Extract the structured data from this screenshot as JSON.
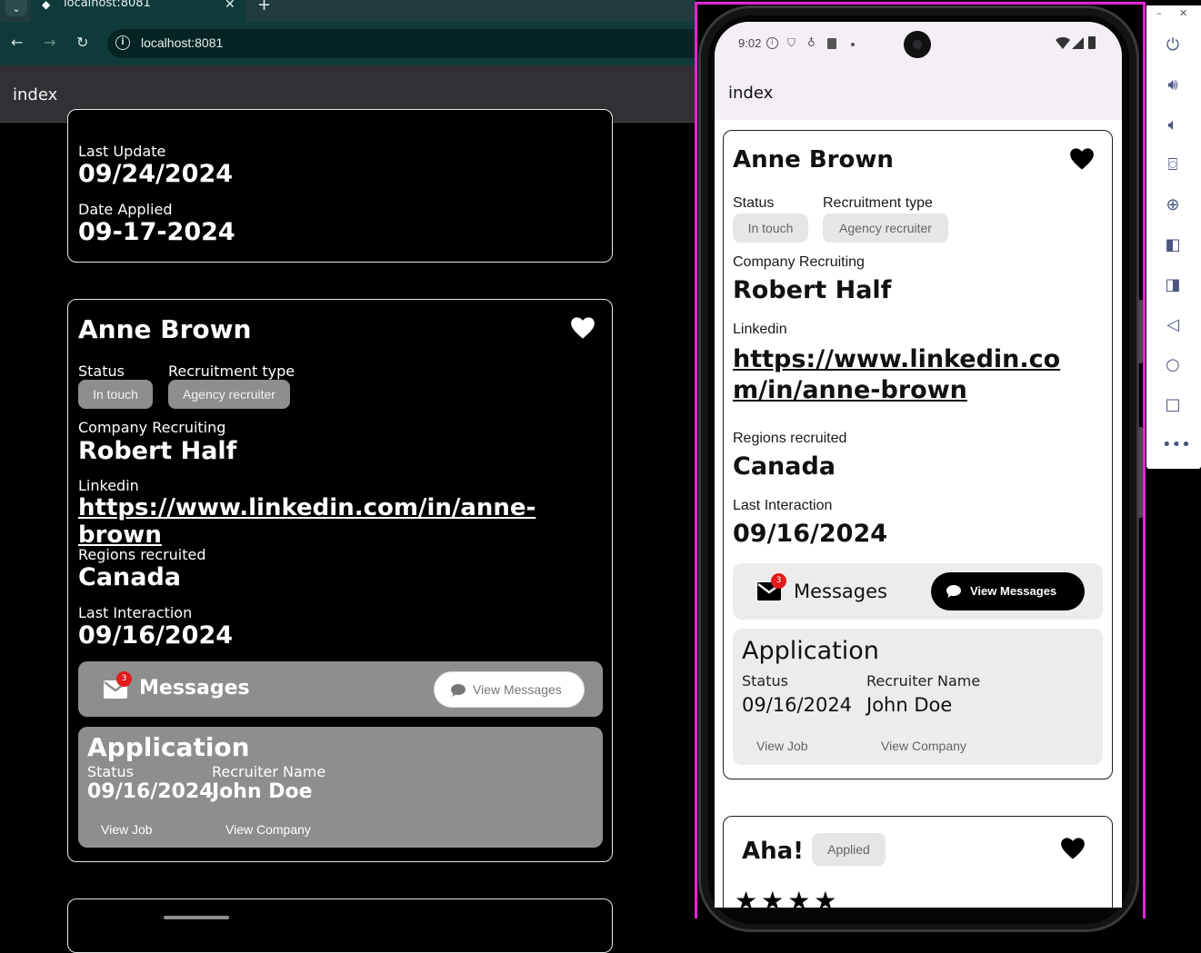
{
  "browser": {
    "tab_title": "localhost:8081",
    "url": "localhost:8081",
    "icons": [
      "tab-dropdown-icon",
      "close-icon",
      "plus-icon",
      "back-icon",
      "forward-icon",
      "reload-icon",
      "site-info-icon"
    ]
  },
  "web": {
    "header_title": "index",
    "card1": {
      "last_update_label": "Last Update",
      "last_update": "09/24/2024",
      "date_applied_label": "Date Applied",
      "date_applied": "09-17-2024"
    },
    "card2": {
      "name": "Anne Brown",
      "status_label": "Status",
      "status_value": "In touch",
      "recruitment_type_label": "Recruitment type",
      "recruitment_type_value": "Agency recruiter",
      "company_label": "Company Recruiting",
      "company": "Robert Half",
      "linkedin_label": "Linkedin",
      "linkedin": "https://www.linkedin.com/in/anne-brown",
      "regions_label": "Regions recruited",
      "regions": "Canada",
      "last_interaction_label": "Last Interaction",
      "last_interaction": "09/16/2024",
      "messages_label": "Messages",
      "messages_badge": "3",
      "view_messages": "View Messages",
      "application_title": "Application",
      "app_status_label": "Status",
      "app_status_value": "09/16/2024",
      "recruiter_name_label": "Recruiter Name",
      "recruiter_name": "John Doe",
      "view_job": "View Job",
      "view_company": "View Company"
    }
  },
  "phone": {
    "time": "9:02",
    "header_title": "index",
    "card": {
      "name": "Anne Brown",
      "status_label": "Status",
      "status_value": "In touch",
      "recruitment_type_label": "Recruitment type",
      "recruitment_type_value": "Agency recruiter",
      "company_label": "Company Recruiting",
      "company": "Robert Half",
      "linkedin_label": "Linkedin",
      "linkedin": "https://www.linkedin.com/in/anne-brown",
      "regions_label": "Regions recruited",
      "regions": "Canada",
      "last_interaction_label": "Last Interaction",
      "last_interaction": "09/16/2024",
      "messages_label": "Messages",
      "messages_badge": "3",
      "view_messages": "View Messages",
      "application_title": "Application",
      "app_status_label": "Status",
      "app_status_value": "09/16/2024",
      "recruiter_name_label": "Recruiter Name",
      "recruiter_name": "John Doe",
      "view_job": "View Job",
      "view_company": "View Company"
    },
    "card2": {
      "name": "Aha!",
      "status_value": "Applied"
    }
  },
  "emulator_toolbar": {
    "icons": [
      "minimize-icon",
      "close-icon",
      "power-icon",
      "volume-up-icon",
      "volume-down-icon",
      "camera-icon",
      "zoom-icon",
      "rotate-left-icon",
      "rotate-right-icon",
      "back-icon",
      "home-icon",
      "overview-icon",
      "more-icon"
    ]
  },
  "colors": {
    "browser_bg": "#0f3a3a",
    "emulator_border": "#e324d6",
    "badge": "#e21b1b"
  }
}
